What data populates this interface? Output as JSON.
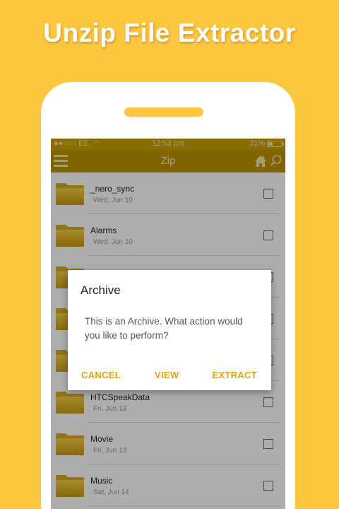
{
  "promo": {
    "title": "Unzip File Extractor"
  },
  "status_bar": {
    "carrier": "EE",
    "time": "12:53 pm",
    "battery_label": "31%",
    "battery_level": 0.31
  },
  "app_bar": {
    "title": "Zip"
  },
  "files": [
    {
      "name": "_nero_sync",
      "date": "Wed, Jun 10"
    },
    {
      "name": "Alarms",
      "date": "Wed, Jun 10"
    },
    {
      "name": "",
      "date": ""
    },
    {
      "name": "",
      "date": ""
    },
    {
      "name": "",
      "date": ""
    },
    {
      "name": "HTCSpeakData",
      "date": "Fri, Jun 13"
    },
    {
      "name": "Movie",
      "date": "Fri, Jun 13"
    },
    {
      "name": "Music",
      "date": "Sat, Jun 14"
    }
  ],
  "dialog": {
    "title": "Archive",
    "message": "This is an Archive. What action would you like to perform?",
    "cancel_label": "CANCEL",
    "view_label": "VIEW",
    "extract_label": "EXTRACT"
  },
  "colors": {
    "background": "#FDC740",
    "app_bar": "#BC9400",
    "accent": "#D7A41E"
  },
  "icons": [
    "menu-icon",
    "home-icon",
    "search-icon",
    "wifi-icon",
    "battery-icon",
    "folder-icon"
  ]
}
